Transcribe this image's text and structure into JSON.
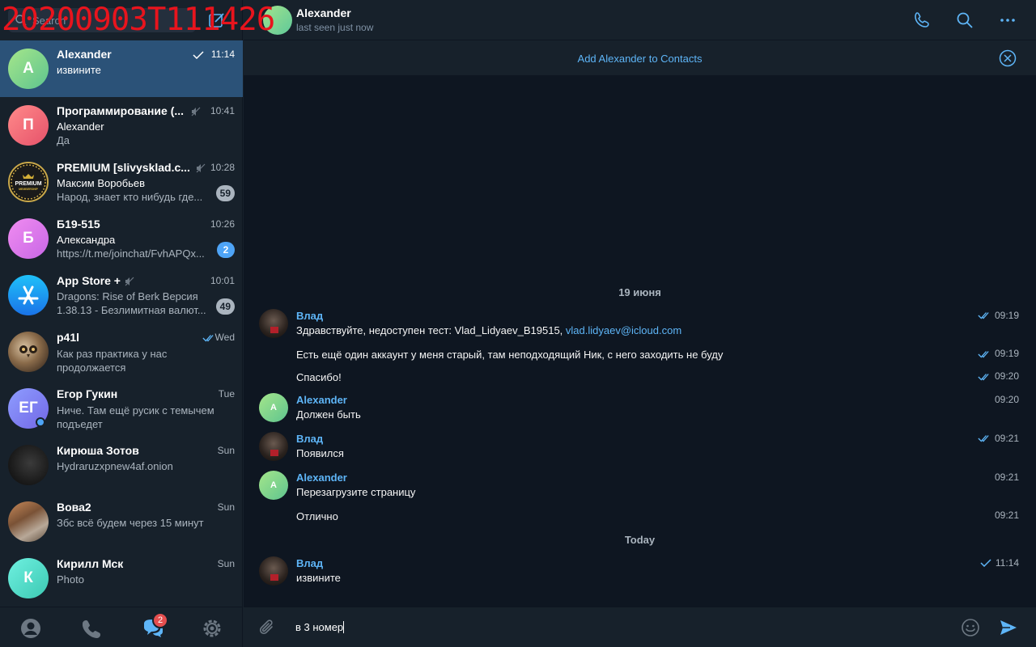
{
  "overlay": {
    "timestamp": "20200903T111426"
  },
  "search": {
    "placeholder": "Search"
  },
  "chats": [
    {
      "name": "Alexander",
      "time": "11:14",
      "sender": "",
      "preview": "извините",
      "avatar_letter": "A",
      "avatar_colors": [
        "#a5e68a",
        "#5ec48f"
      ],
      "active": true,
      "read_check": "single"
    },
    {
      "name": "Программирование (...",
      "time": "10:41",
      "sender": "Alexander",
      "preview": "Да",
      "avatar_letter": "П",
      "avatar_colors": [
        "#ff8a8a",
        "#e6526a"
      ],
      "muted": true
    },
    {
      "name": "PREMIUM [slivysklad.c...",
      "time": "10:28",
      "sender": "Максим Воробьев",
      "preview": "Народ, знает кто нибудь где...",
      "avatar_letter": "",
      "avatar_logo": "PREMIUM",
      "muted": true,
      "badge": "59",
      "badge_color": "#aab4be"
    },
    {
      "name": "Б19-515",
      "time": "10:26",
      "sender": "Александра",
      "preview": "https://t.me/joinchat/FvhAPQx...",
      "avatar_letter": "Б",
      "avatar_colors": [
        "#f08cf0",
        "#c867e6"
      ],
      "badge": "2",
      "badge_color": "#4ea4f6"
    },
    {
      "name": "App Store +",
      "time": "10:01",
      "sender": "Dragons: Rise of Berk Версия",
      "preview": "1.38.13  - Безлимитная валют...",
      "avatar_letter": "",
      "avatar_icon": "app-store",
      "muted": true,
      "badge": "49",
      "badge_color": "#aab4be"
    },
    {
      "name": "p41l",
      "time": "Wed",
      "sender": "",
      "preview": "Как раз практика у нас продолжается",
      "avatar_letter": "",
      "avatar_photo": "owl",
      "read_check": "double",
      "two_line": true
    },
    {
      "name": "Егор Гукин",
      "time": "Tue",
      "sender": "",
      "preview": "Ниче. Там ещё русик с темычем подъедет",
      "avatar_letter": "ЕГ",
      "avatar_colors": [
        "#8e9dff",
        "#7267e6"
      ],
      "online": true,
      "two_line": true
    },
    {
      "name": "Кирюша Зотов",
      "time": "Sun",
      "sender": "",
      "preview": "Hydraruzxpnew4af.onion",
      "avatar_letter": "",
      "avatar_photo": "dark",
      "one_line": true
    },
    {
      "name": "Вова2",
      "time": "Sun",
      "sender": "",
      "preview": "Збс всё будем через 15 минут",
      "avatar_letter": "",
      "avatar_photo": "food",
      "one_line": true
    },
    {
      "name": "Кирилл Мск",
      "time": "Sun",
      "sender": "",
      "preview": "Photo",
      "avatar_letter": "К",
      "avatar_colors": [
        "#6ff0e0",
        "#3cc9b3"
      ],
      "one_line": true
    }
  ],
  "bottom_nav": {
    "badge": "2"
  },
  "header": {
    "name": "Alexander",
    "status": "last seen just now"
  },
  "addbar": {
    "text": "Add Alexander to Contacts"
  },
  "messages": {
    "date1": "19 июня",
    "date2": "Today",
    "items": [
      {
        "author": "Влад",
        "text": "Здравствуйте, недоступен тест: Vlad_Lidyaev_B19515, ",
        "link": "vlad.lidyaev@icloud.com",
        "time": "09:19",
        "check": "double"
      },
      {
        "author": "",
        "text": "Есть ещё один аккаунт у меня старый, там неподходящий Ник, с него заходить не буду",
        "time": "09:19",
        "check": "double"
      },
      {
        "author": "",
        "text": "Спасибо!",
        "time": "09:20",
        "check": "double"
      },
      {
        "author": "Alexander",
        "text": "Должен быть",
        "time": "09:20"
      },
      {
        "author": "Влад",
        "text": "Появился",
        "time": "09:21",
        "check": "double"
      },
      {
        "author": "Alexander",
        "text": "Перезагрузите страницу",
        "time": "09:21"
      },
      {
        "author": "",
        "text": "Отлично",
        "time": "09:21"
      },
      {
        "author": "Влад",
        "text": "извините",
        "time": "11:14",
        "check": "single"
      }
    ]
  },
  "composer": {
    "text": "в 3 номер"
  },
  "colors": {
    "accent": "#5eb5f7",
    "active": "#2b5278",
    "bg": "#0e1621",
    "panel": "#17212b"
  }
}
